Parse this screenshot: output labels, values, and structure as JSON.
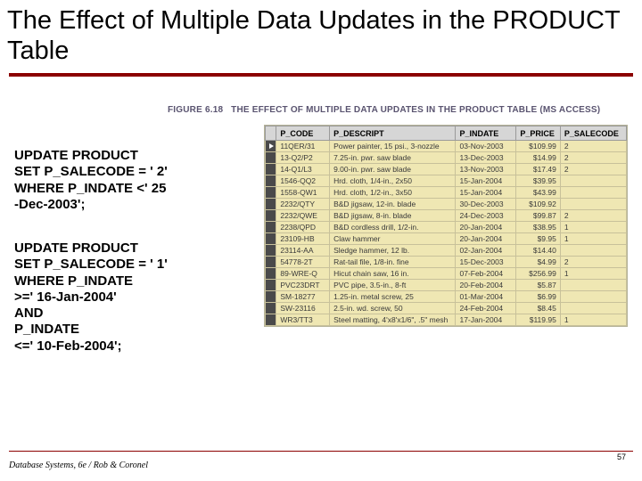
{
  "title": "The Effect of Multiple Data Updates in the PRODUCT Table",
  "figure": {
    "label": "FIGURE 6.18",
    "caption": "THE EFFECT OF MULTIPLE DATA UPDATES IN THE PRODUCT TABLE (MS ACCESS)"
  },
  "sql1": {
    "l1": "UPDATE PRODUCT",
    "l2": "SET P_SALECODE = ' 2'",
    "l3": "WHERE P_INDATE <' 25",
    "l4": "-Dec-2003';"
  },
  "sql2": {
    "l1": "UPDATE PRODUCT",
    "l2": "SET P_SALECODE = ' 1'",
    "l3": "WHERE P_INDATE",
    "l4": ">=' 16-Jan-2004'",
    "l5": "AND",
    "l6": "P_INDATE",
    "l7": "<=' 10-Feb-2004';"
  },
  "table": {
    "headers": {
      "sel": "",
      "code": "P_CODE",
      "desc": "P_DESCRIPT",
      "indate": "P_INDATE",
      "price": "P_PRICE",
      "sale": "P_SALECODE"
    },
    "rows": [
      {
        "sel": "▶",
        "code": "11QER/31",
        "desc": "Power painter, 15 psi., 3-nozzle",
        "indate": "03-Nov-2003",
        "price": "$109.99",
        "sale": "2"
      },
      {
        "sel": "",
        "code": "13-Q2/P2",
        "desc": "7.25-in. pwr. saw blade",
        "indate": "13-Dec-2003",
        "price": "$14.99",
        "sale": "2"
      },
      {
        "sel": "",
        "code": "14-Q1/L3",
        "desc": "9.00-in. pwr. saw blade",
        "indate": "13-Nov-2003",
        "price": "$17.49",
        "sale": "2"
      },
      {
        "sel": "",
        "code": "1546-QQ2",
        "desc": "Hrd. cloth, 1/4-in., 2x50",
        "indate": "15-Jan-2004",
        "price": "$39.95",
        "sale": ""
      },
      {
        "sel": "",
        "code": "1558-QW1",
        "desc": "Hrd. cloth, 1/2-in., 3x50",
        "indate": "15-Jan-2004",
        "price": "$43.99",
        "sale": ""
      },
      {
        "sel": "",
        "code": "2232/QTY",
        "desc": "B&D jigsaw, 12-in. blade",
        "indate": "30-Dec-2003",
        "price": "$109.92",
        "sale": ""
      },
      {
        "sel": "",
        "code": "2232/QWE",
        "desc": "B&D jigsaw, 8-in. blade",
        "indate": "24-Dec-2003",
        "price": "$99.87",
        "sale": "2"
      },
      {
        "sel": "",
        "code": "2238/QPD",
        "desc": "B&D cordless drill, 1/2-in.",
        "indate": "20-Jan-2004",
        "price": "$38.95",
        "sale": "1"
      },
      {
        "sel": "",
        "code": "23109-HB",
        "desc": "Claw hammer",
        "indate": "20-Jan-2004",
        "price": "$9.95",
        "sale": "1"
      },
      {
        "sel": "",
        "code": "23114-AA",
        "desc": "Sledge hammer, 12 lb.",
        "indate": "02-Jan-2004",
        "price": "$14.40",
        "sale": ""
      },
      {
        "sel": "",
        "code": "54778-2T",
        "desc": "Rat-tail file, 1/8-in. fine",
        "indate": "15-Dec-2003",
        "price": "$4.99",
        "sale": "2"
      },
      {
        "sel": "",
        "code": "89-WRE-Q",
        "desc": "Hicut chain saw, 16 in.",
        "indate": "07-Feb-2004",
        "price": "$256.99",
        "sale": "1"
      },
      {
        "sel": "",
        "code": "PVC23DRT",
        "desc": "PVC pipe, 3.5-in., 8-ft",
        "indate": "20-Feb-2004",
        "price": "$5.87",
        "sale": ""
      },
      {
        "sel": "",
        "code": "SM-18277",
        "desc": "1.25-in. metal screw, 25",
        "indate": "01-Mar-2004",
        "price": "$6.99",
        "sale": ""
      },
      {
        "sel": "",
        "code": "SW-23116",
        "desc": "2.5-in. wd. screw, 50",
        "indate": "24-Feb-2004",
        "price": "$8.45",
        "sale": ""
      },
      {
        "sel": "",
        "code": "WR3/TT3",
        "desc": "Steel matting, 4'x8'x1/6\", .5\" mesh",
        "indate": "17-Jan-2004",
        "price": "$119.95",
        "sale": "1"
      }
    ]
  },
  "footer": "Database Systems, 6e / Rob & Coronel",
  "page": "57"
}
